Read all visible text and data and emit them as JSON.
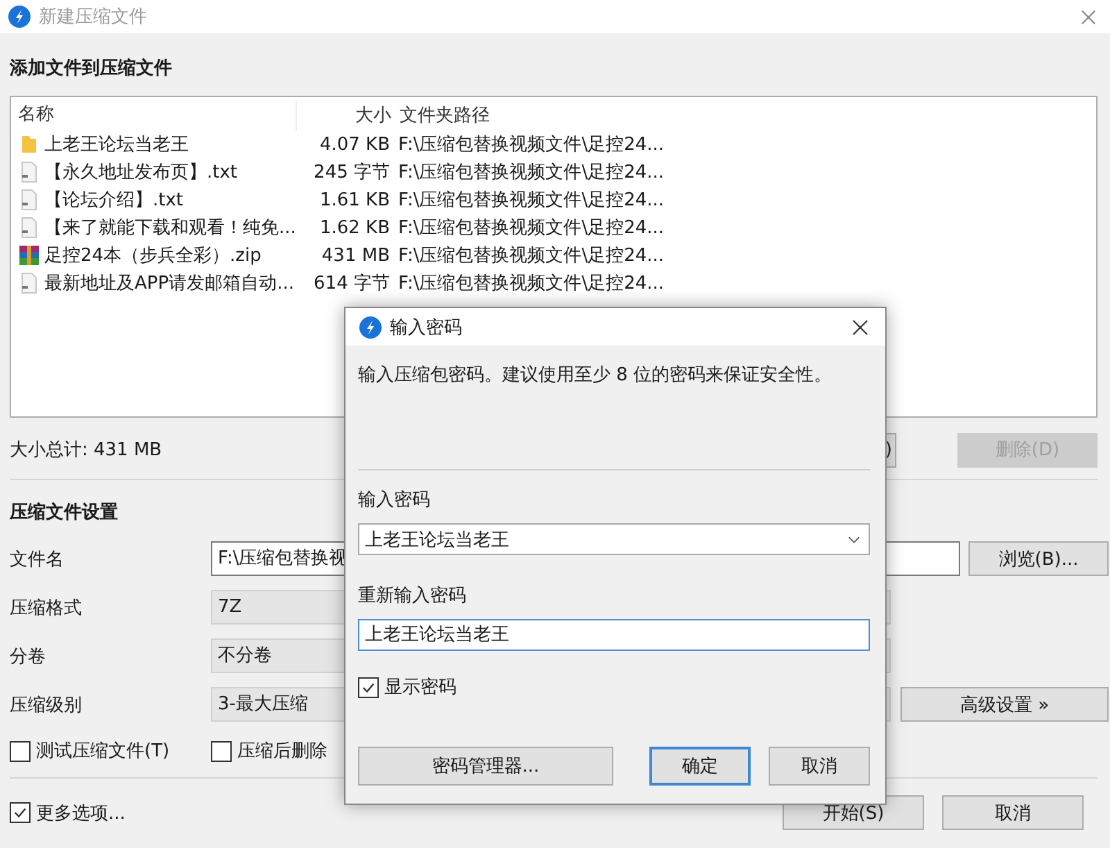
{
  "window": {
    "title": "新建压缩文件"
  },
  "add_section": {
    "heading": "添加文件到压缩文件"
  },
  "file_list": {
    "columns": [
      "名称",
      "大小",
      "文件夹路径"
    ],
    "rows": [
      {
        "kind": "folder",
        "name": "上老王论坛当老王",
        "size": "4.07 KB",
        "path": "F:\\压缩包替换视频文件\\足控24..."
      },
      {
        "kind": "text",
        "name": "【永久地址发布页】.txt",
        "size": "245 字节",
        "path": "F:\\压缩包替换视频文件\\足控24..."
      },
      {
        "kind": "text",
        "name": "【论坛介绍】.txt",
        "size": "1.61 KB",
        "path": "F:\\压缩包替换视频文件\\足控24..."
      },
      {
        "kind": "text",
        "name": "【来了就能下载和观看！纯免...",
        "size": "1.62 KB",
        "path": "F:\\压缩包替换视频文件\\足控24..."
      },
      {
        "kind": "archive",
        "name": "足控24本（步兵全彩）.zip",
        "size": "431 MB",
        "path": "F:\\压缩包替换视频文件\\足控24..."
      },
      {
        "kind": "text",
        "name": "最新地址及APP请发邮箱自动...",
        "size": "614 字节",
        "path": "F:\\压缩包替换视频文件\\足控24..."
      }
    ]
  },
  "total": "大小总计: 431 MB",
  "list_buttons": [
    {
      "label": ")",
      "disabled": false
    },
    {
      "label": "删除(D)",
      "disabled": true
    }
  ],
  "settings": {
    "heading": "压缩文件设置",
    "fields": [
      {
        "kind": "text",
        "label": "文件名",
        "value": "F:\\压缩包替换视"
      },
      {
        "kind": "select",
        "label": "压缩格式",
        "value": "7Z"
      },
      {
        "kind": "select",
        "label": "分卷",
        "value": "不分卷"
      },
      {
        "kind": "select",
        "label": "压缩级别",
        "value": "3-最大压缩"
      }
    ]
  },
  "browse_button": "浏览(B)...",
  "advanced_button": "高级设置 »",
  "options": [
    {
      "label": "测试压缩文件(T)",
      "checked": false
    },
    {
      "label": "压缩后删除",
      "checked": false
    }
  ],
  "more_options": {
    "label": "更多选项...",
    "checked": true
  },
  "footer_buttons": [
    "开始(S)",
    "取消"
  ],
  "dialog": {
    "title": "输入密码",
    "message": "输入压缩包密码。建议使用至少 8 位的密码来保证安全性。",
    "password_label": "输入密码",
    "password_value": "上老王论坛当老王",
    "confirm_label": "重新输入密码",
    "confirm_value": "上老王论坛当老王",
    "show_password": {
      "label": "显示密码",
      "checked": true
    },
    "buttons": [
      {
        "label": "密码管理器...",
        "default": false
      },
      {
        "label": "确定",
        "default": true
      },
      {
        "label": "取消",
        "default": false
      }
    ]
  }
}
